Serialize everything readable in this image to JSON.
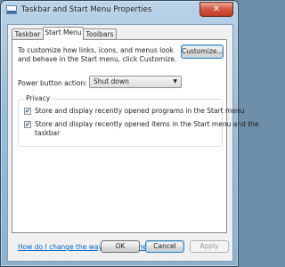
{
  "window": {
    "title": "Taskbar and Start Menu Properties",
    "close_glyph": "✕"
  },
  "tabs": [
    {
      "label": "Taskbar",
      "active": false
    },
    {
      "label": "Start Menu",
      "active": true
    },
    {
      "label": "Toolbars",
      "active": false
    }
  ],
  "start_menu": {
    "description": "To customize how links, icons, and menus look and behave in the Start menu, click Customize.",
    "customize_button": "Customize...",
    "power_label": "Power button action:",
    "power_value": "Shut down",
    "privacy": {
      "title": "Privacy",
      "items": [
        {
          "text": "Store and display recently opened programs in the Start menu",
          "checked": true,
          "mark": "✔"
        },
        {
          "text": "Store and display recently opened items in the Start menu and the",
          "text2": "taskbar",
          "checked": true,
          "mark": "✔"
        }
      ]
    },
    "help_link": "How do I change the way the Start menu looks?"
  },
  "footer": {
    "ok": "OK",
    "cancel": "Cancel",
    "apply": "Apply"
  }
}
